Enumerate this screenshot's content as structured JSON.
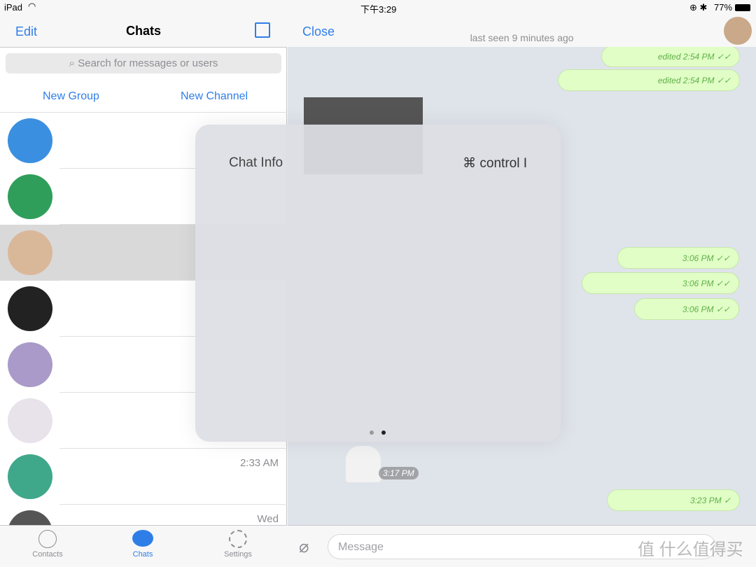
{
  "status_bar": {
    "device": "iPad",
    "time": "下午3:29",
    "battery": "77%"
  },
  "sidebar": {
    "edit_label": "Edit",
    "title": "Chats",
    "search_placeholder": "Search for messages or users",
    "new_group": "New Group",
    "new_channel": "New Channel",
    "chats": [
      {
        "time": "",
        "avatar_color": "#3b8fe0"
      },
      {
        "time": "",
        "avatar_color": "#2f9e5b"
      },
      {
        "time": "",
        "avatar_color": "#d9b89a",
        "selected": true
      },
      {
        "time": "",
        "avatar_color": "#222222"
      },
      {
        "time": "",
        "avatar_color": "#a99ac9"
      },
      {
        "time": "",
        "avatar_color": "#e8e2ea"
      },
      {
        "time": "2:33 AM",
        "avatar_color": "#3fa88a"
      },
      {
        "time": "Wed",
        "avatar_color": "#555555"
      }
    ]
  },
  "tab_bar": {
    "items": [
      {
        "label": "Contacts"
      },
      {
        "label": "Chats",
        "active": true
      },
      {
        "label": "Settings"
      }
    ]
  },
  "chat": {
    "close_label": "Close",
    "status": "last seen 9 minutes ago",
    "messages": [
      {
        "meta": "edited 2:54 PM",
        "ticks": "✓✓"
      },
      {
        "meta": "edited 2:54 PM",
        "ticks": "✓✓"
      },
      {
        "meta": "3:06 PM",
        "ticks": "✓✓"
      },
      {
        "meta": "3:06 PM",
        "ticks": "✓✓"
      },
      {
        "meta": "3:06 PM",
        "ticks": "✓✓"
      },
      {
        "meta": "3:17 PM",
        "incoming": true
      },
      {
        "meta": "3:23 PM",
        "ticks": "✓"
      }
    ],
    "input_placeholder": "Message"
  },
  "overlay": {
    "label": "Chat Info",
    "shortcut": "⌘ control I",
    "page_count": 2,
    "current_page": 2
  },
  "watermark": "值 什么值得买",
  "colors": {
    "accent": "#2f7ee8",
    "bubble": "#e1fec6",
    "meta": "#5fb04a"
  }
}
